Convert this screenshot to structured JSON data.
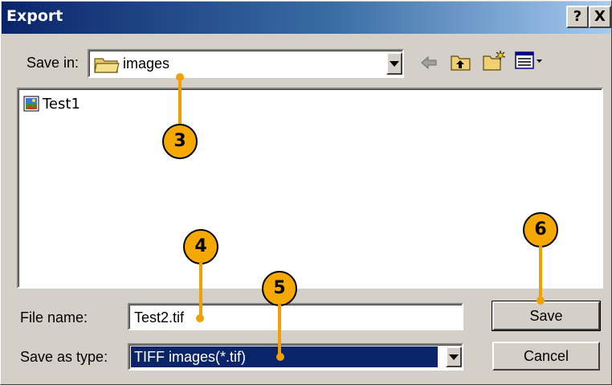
{
  "window": {
    "title": "Export",
    "help_label": "?",
    "close_label": "X"
  },
  "save_in": {
    "label": "Save in:",
    "value": "images",
    "icon": "folder-icon"
  },
  "toolbar": {
    "back_icon": "back-arrow-icon",
    "up_icon": "up-folder-icon",
    "new_folder_icon": "new-folder-icon",
    "view_icon": "view-menu-icon"
  },
  "file_list": {
    "items": [
      {
        "name": "Test1",
        "icon": "image-file-icon"
      }
    ]
  },
  "file_name": {
    "label": "File name:",
    "value": "Test2.tif"
  },
  "save_as_type": {
    "label": "Save as type:",
    "value": "TIFF images(*.tif)"
  },
  "buttons": {
    "save_label": "Save",
    "cancel_label": "Cancel"
  },
  "callouts": {
    "c3": "3",
    "c4": "4",
    "c5": "5",
    "c6": "6"
  },
  "colors": {
    "callout": "#f5a800",
    "title_start": "#0a246a",
    "title_end": "#a6caf0",
    "selection": "#0a246a"
  }
}
